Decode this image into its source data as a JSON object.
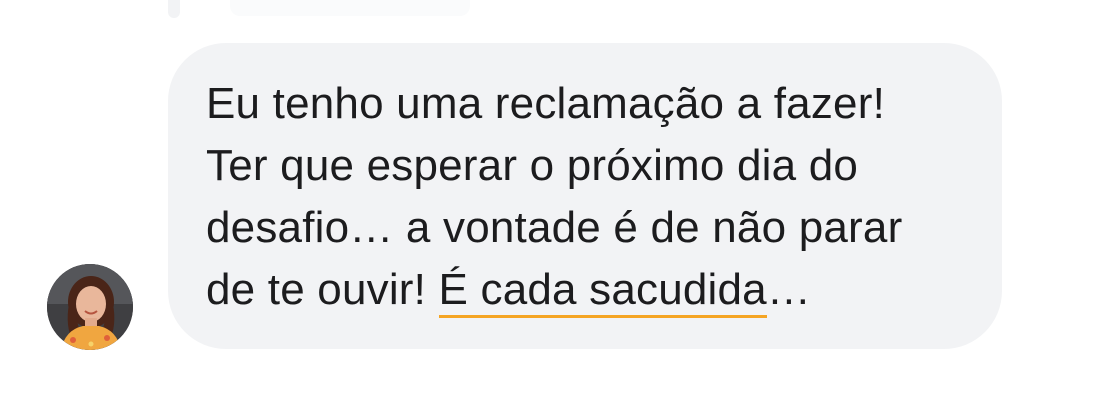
{
  "message": {
    "lines": [
      "Eu tenho uma reclamação a fazer!",
      "Ter que esperar o próximo dia do",
      "desafio… a vontade é de não parar"
    ],
    "last_line": {
      "prefix": "de te ouvir! ",
      "highlighted": "É cada sacudida",
      "suffix": "…"
    }
  },
  "colors": {
    "bubble_background": "#f2f3f5",
    "text": "#1c1c1e",
    "highlight_underline": "#f5a524"
  },
  "icons": {
    "avatar": "user-avatar-photo"
  }
}
